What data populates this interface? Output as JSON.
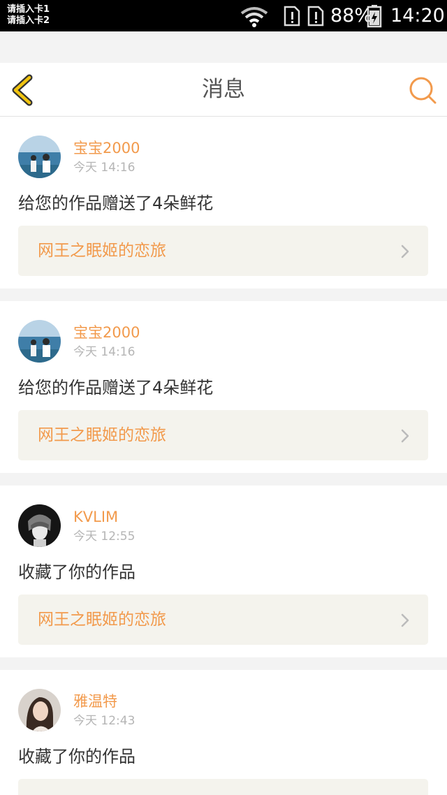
{
  "status_bar": {
    "sim1": "请插入卡1",
    "sim2": "请插入卡2",
    "battery": "88%",
    "time": "14:20"
  },
  "header": {
    "title": "消息",
    "back_icon": "chevron-left-icon",
    "search_icon": "search-icon"
  },
  "colors": {
    "accent": "#f29a4c",
    "back_icon": "#f1c40f",
    "time_text": "#b5b5b5",
    "body_text": "#333333",
    "link_background": "#f4f3ed"
  },
  "notifications": [
    {
      "username": "宝宝2000",
      "time": "今天 14:16",
      "message": "给您的作品赠送了4朵鲜花",
      "work_title": "网王之眠姬的恋旅"
    },
    {
      "username": "宝宝2000",
      "time": "今天 14:16",
      "message": "给您的作品赠送了4朵鲜花",
      "work_title": "网王之眠姬的恋旅"
    },
    {
      "username": "KVLIM",
      "time": "今天 12:55",
      "message": "收藏了你的作品",
      "work_title": "网王之眠姬的恋旅"
    },
    {
      "username": "雅温特",
      "time": "今天 12:43",
      "message": "收藏了你的作品",
      "work_title": ""
    }
  ]
}
